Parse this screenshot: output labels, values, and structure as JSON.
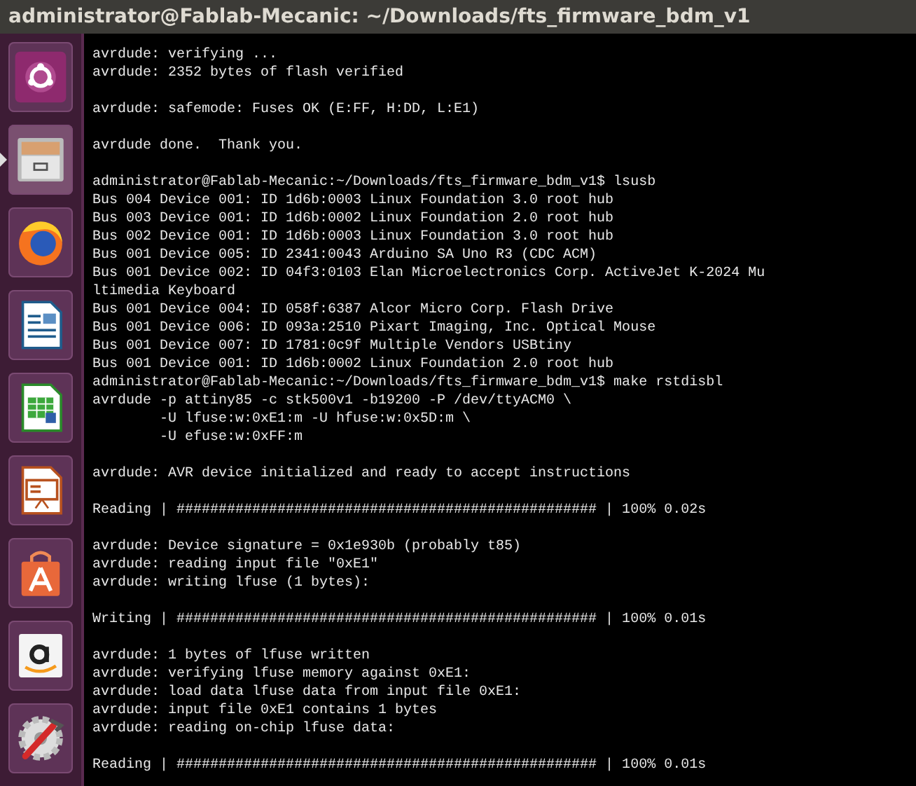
{
  "window": {
    "title": "administrator@Fablab-Mecanic: ~/Downloads/fts_firmware_bdm_v1"
  },
  "launcher": [
    {
      "kind": "ubuntu",
      "running": false
    },
    {
      "kind": "files",
      "running": true
    },
    {
      "kind": "firefox",
      "running": false
    },
    {
      "kind": "writer",
      "running": false
    },
    {
      "kind": "calc",
      "running": false
    },
    {
      "kind": "impress",
      "running": false
    },
    {
      "kind": "store",
      "running": false
    },
    {
      "kind": "amazon",
      "running": false
    },
    {
      "kind": "settings",
      "running": false
    }
  ],
  "terminal": {
    "blocks": [
      [
        "avrdude: verifying ...",
        "avrdude: 2352 bytes of flash verified"
      ],
      [
        "avrdude: safemode: Fuses OK (E:FF, H:DD, L:E1)"
      ],
      [
        "avrdude done.  Thank you."
      ],
      [
        "administrator@Fablab-Mecanic:~/Downloads/fts_firmware_bdm_v1$ lsusb",
        "Bus 004 Device 001: ID 1d6b:0003 Linux Foundation 3.0 root hub",
        "Bus 003 Device 001: ID 1d6b:0002 Linux Foundation 2.0 root hub",
        "Bus 002 Device 001: ID 1d6b:0003 Linux Foundation 3.0 root hub",
        "Bus 001 Device 005: ID 2341:0043 Arduino SA Uno R3 (CDC ACM)",
        "Bus 001 Device 002: ID 04f3:0103 Elan Microelectronics Corp. ActiveJet K-2024 Mu",
        "ltimedia Keyboard",
        "Bus 001 Device 004: ID 058f:6387 Alcor Micro Corp. Flash Drive",
        "Bus 001 Device 006: ID 093a:2510 Pixart Imaging, Inc. Optical Mouse",
        "Bus 001 Device 007: ID 1781:0c9f Multiple Vendors USBtiny",
        "Bus 001 Device 001: ID 1d6b:0002 Linux Foundation 2.0 root hub",
        "administrator@Fablab-Mecanic:~/Downloads/fts_firmware_bdm_v1$ make rstdisbl",
        "avrdude -p attiny85 -c stk500v1 -b19200 -P /dev/ttyACM0 \\",
        "        -U lfuse:w:0xE1:m -U hfuse:w:0x5D:m \\",
        "        -U efuse:w:0xFF:m"
      ],
      [
        "avrdude: AVR device initialized and ready to accept instructions"
      ],
      [
        "Reading | ################################################## | 100% 0.02s"
      ],
      [
        "avrdude: Device signature = 0x1e930b (probably t85)",
        "avrdude: reading input file \"0xE1\"",
        "avrdude: writing lfuse (1 bytes):"
      ],
      [
        "Writing | ################################################## | 100% 0.01s"
      ],
      [
        "avrdude: 1 bytes of lfuse written",
        "avrdude: verifying lfuse memory against 0xE1:",
        "avrdude: load data lfuse data from input file 0xE1:",
        "avrdude: input file 0xE1 contains 1 bytes",
        "avrdude: reading on-chip lfuse data:"
      ],
      [
        "Reading | ################################################## | 100% 0.01s"
      ]
    ]
  }
}
